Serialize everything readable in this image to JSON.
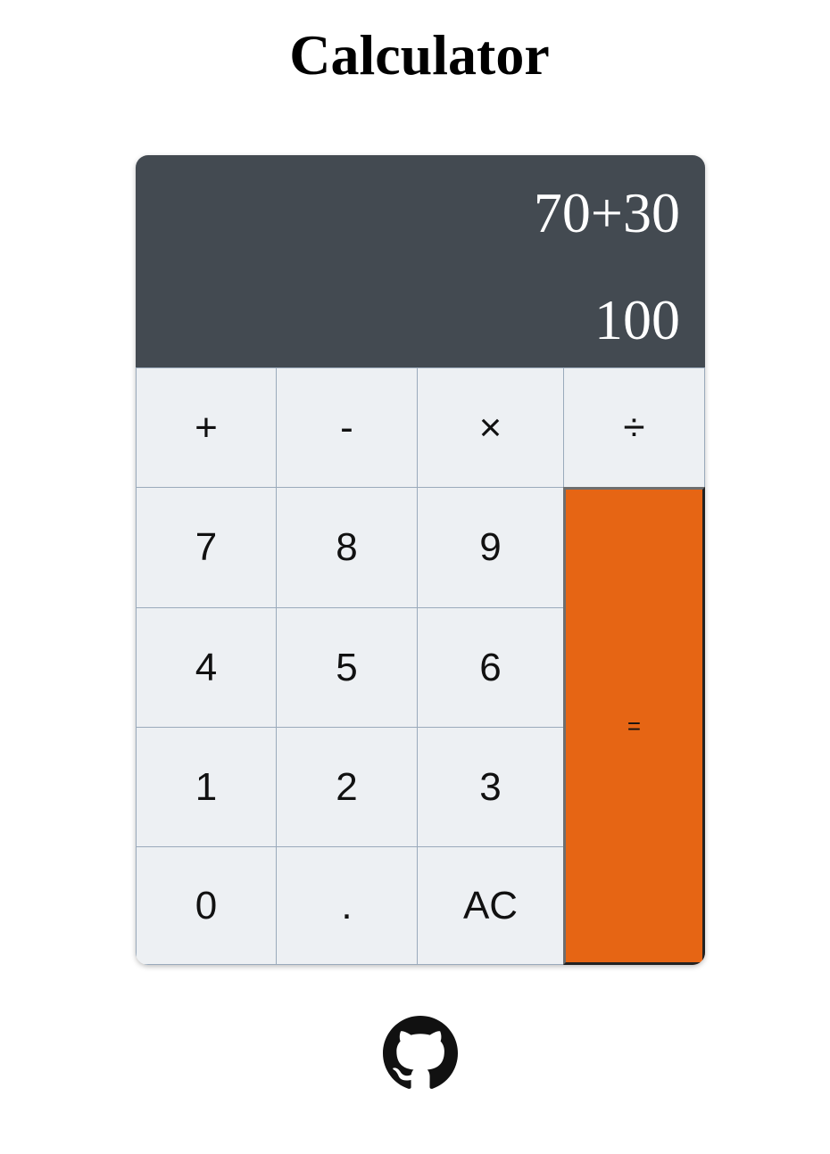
{
  "page": {
    "title": "Calculator"
  },
  "display": {
    "expression": "70+30",
    "result": "100"
  },
  "keys": {
    "add": "+",
    "subtract": "-",
    "multiply": "×",
    "divide": "÷",
    "seven": "7",
    "eight": "8",
    "nine": "9",
    "four": "4",
    "five": "5",
    "six": "6",
    "one": "1",
    "two": "2",
    "three": "3",
    "zero": "0",
    "decimal": ".",
    "clear": "AC",
    "equals": "="
  },
  "footer": {
    "icon": "github-icon"
  },
  "colors": {
    "display_bg": "#434a51",
    "key_bg": "#edf0f3",
    "equals_bg": "#e66514",
    "key_border": "#9aaabb"
  }
}
